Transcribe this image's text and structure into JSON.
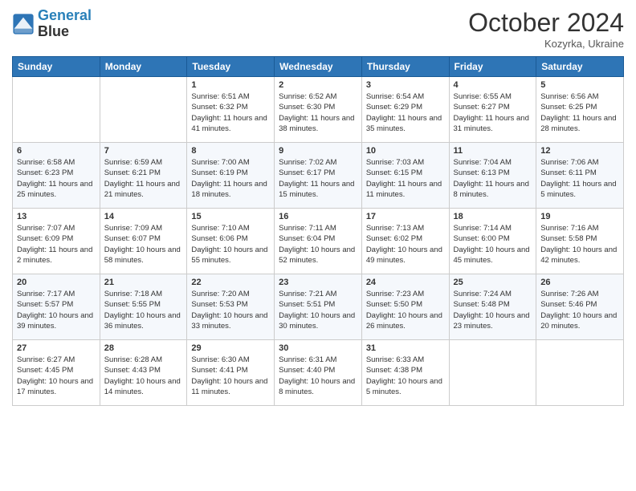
{
  "header": {
    "logo_line1": "General",
    "logo_line2": "Blue",
    "month_title": "October 2024",
    "location": "Kozyrka, Ukraine"
  },
  "days_of_week": [
    "Sunday",
    "Monday",
    "Tuesday",
    "Wednesday",
    "Thursday",
    "Friday",
    "Saturday"
  ],
  "weeks": [
    [
      {
        "day": "",
        "info": ""
      },
      {
        "day": "",
        "info": ""
      },
      {
        "day": "1",
        "info": "Sunrise: 6:51 AM\nSunset: 6:32 PM\nDaylight: 11 hours and 41 minutes."
      },
      {
        "day": "2",
        "info": "Sunrise: 6:52 AM\nSunset: 6:30 PM\nDaylight: 11 hours and 38 minutes."
      },
      {
        "day": "3",
        "info": "Sunrise: 6:54 AM\nSunset: 6:29 PM\nDaylight: 11 hours and 35 minutes."
      },
      {
        "day": "4",
        "info": "Sunrise: 6:55 AM\nSunset: 6:27 PM\nDaylight: 11 hours and 31 minutes."
      },
      {
        "day": "5",
        "info": "Sunrise: 6:56 AM\nSunset: 6:25 PM\nDaylight: 11 hours and 28 minutes."
      }
    ],
    [
      {
        "day": "6",
        "info": "Sunrise: 6:58 AM\nSunset: 6:23 PM\nDaylight: 11 hours and 25 minutes."
      },
      {
        "day": "7",
        "info": "Sunrise: 6:59 AM\nSunset: 6:21 PM\nDaylight: 11 hours and 21 minutes."
      },
      {
        "day": "8",
        "info": "Sunrise: 7:00 AM\nSunset: 6:19 PM\nDaylight: 11 hours and 18 minutes."
      },
      {
        "day": "9",
        "info": "Sunrise: 7:02 AM\nSunset: 6:17 PM\nDaylight: 11 hours and 15 minutes."
      },
      {
        "day": "10",
        "info": "Sunrise: 7:03 AM\nSunset: 6:15 PM\nDaylight: 11 hours and 11 minutes."
      },
      {
        "day": "11",
        "info": "Sunrise: 7:04 AM\nSunset: 6:13 PM\nDaylight: 11 hours and 8 minutes."
      },
      {
        "day": "12",
        "info": "Sunrise: 7:06 AM\nSunset: 6:11 PM\nDaylight: 11 hours and 5 minutes."
      }
    ],
    [
      {
        "day": "13",
        "info": "Sunrise: 7:07 AM\nSunset: 6:09 PM\nDaylight: 11 hours and 2 minutes."
      },
      {
        "day": "14",
        "info": "Sunrise: 7:09 AM\nSunset: 6:07 PM\nDaylight: 10 hours and 58 minutes."
      },
      {
        "day": "15",
        "info": "Sunrise: 7:10 AM\nSunset: 6:06 PM\nDaylight: 10 hours and 55 minutes."
      },
      {
        "day": "16",
        "info": "Sunrise: 7:11 AM\nSunset: 6:04 PM\nDaylight: 10 hours and 52 minutes."
      },
      {
        "day": "17",
        "info": "Sunrise: 7:13 AM\nSunset: 6:02 PM\nDaylight: 10 hours and 49 minutes."
      },
      {
        "day": "18",
        "info": "Sunrise: 7:14 AM\nSunset: 6:00 PM\nDaylight: 10 hours and 45 minutes."
      },
      {
        "day": "19",
        "info": "Sunrise: 7:16 AM\nSunset: 5:58 PM\nDaylight: 10 hours and 42 minutes."
      }
    ],
    [
      {
        "day": "20",
        "info": "Sunrise: 7:17 AM\nSunset: 5:57 PM\nDaylight: 10 hours and 39 minutes."
      },
      {
        "day": "21",
        "info": "Sunrise: 7:18 AM\nSunset: 5:55 PM\nDaylight: 10 hours and 36 minutes."
      },
      {
        "day": "22",
        "info": "Sunrise: 7:20 AM\nSunset: 5:53 PM\nDaylight: 10 hours and 33 minutes."
      },
      {
        "day": "23",
        "info": "Sunrise: 7:21 AM\nSunset: 5:51 PM\nDaylight: 10 hours and 30 minutes."
      },
      {
        "day": "24",
        "info": "Sunrise: 7:23 AM\nSunset: 5:50 PM\nDaylight: 10 hours and 26 minutes."
      },
      {
        "day": "25",
        "info": "Sunrise: 7:24 AM\nSunset: 5:48 PM\nDaylight: 10 hours and 23 minutes."
      },
      {
        "day": "26",
        "info": "Sunrise: 7:26 AM\nSunset: 5:46 PM\nDaylight: 10 hours and 20 minutes."
      }
    ],
    [
      {
        "day": "27",
        "info": "Sunrise: 6:27 AM\nSunset: 4:45 PM\nDaylight: 10 hours and 17 minutes."
      },
      {
        "day": "28",
        "info": "Sunrise: 6:28 AM\nSunset: 4:43 PM\nDaylight: 10 hours and 14 minutes."
      },
      {
        "day": "29",
        "info": "Sunrise: 6:30 AM\nSunset: 4:41 PM\nDaylight: 10 hours and 11 minutes."
      },
      {
        "day": "30",
        "info": "Sunrise: 6:31 AM\nSunset: 4:40 PM\nDaylight: 10 hours and 8 minutes."
      },
      {
        "day": "31",
        "info": "Sunrise: 6:33 AM\nSunset: 4:38 PM\nDaylight: 10 hours and 5 minutes."
      },
      {
        "day": "",
        "info": ""
      },
      {
        "day": "",
        "info": ""
      }
    ]
  ]
}
